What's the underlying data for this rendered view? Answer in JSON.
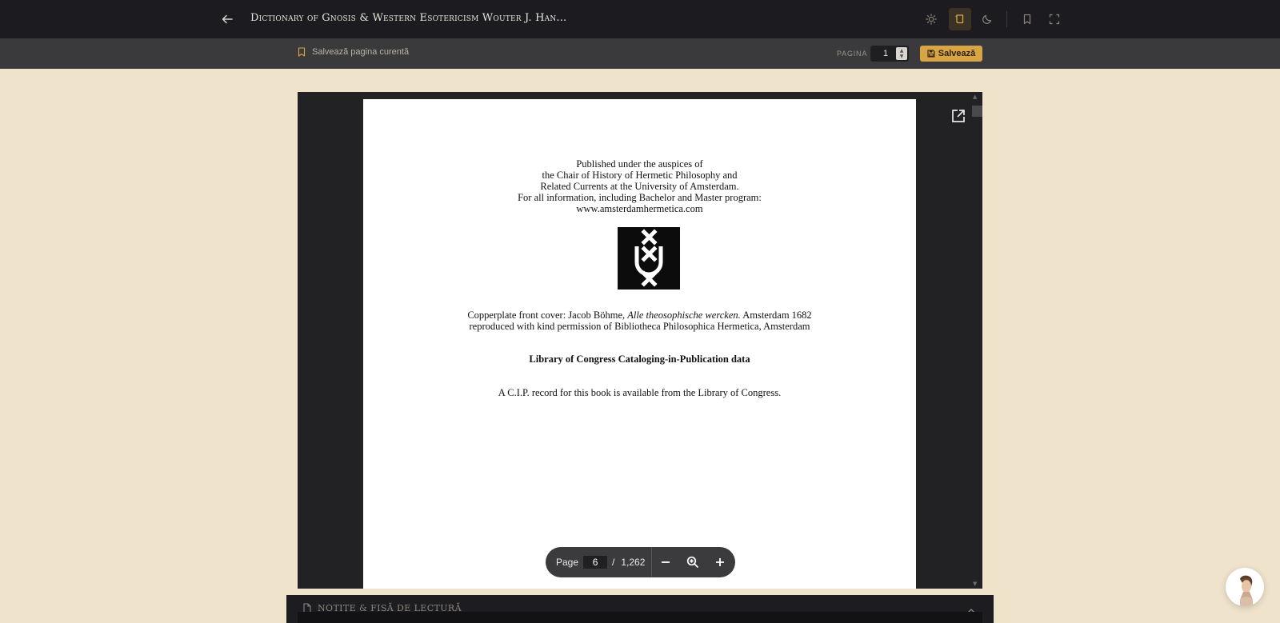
{
  "header": {
    "title": "Dictionary of Gnosis & Western Esotericism Wouter J. Han...",
    "icons": [
      "arrow-left-icon",
      "sun-icon",
      "sepia-book-icon",
      "moon-icon",
      "bookmark-icon",
      "fullscreen-icon"
    ],
    "active_theme": "sepia",
    "accent_color": "#d9a544"
  },
  "subbar": {
    "save_current_label": "Salvează pagina curentă",
    "page_label": "PAGINA",
    "page_value": "1",
    "save_button_label": "Salvează"
  },
  "document": {
    "lines": {
      "l1": "Published under the auspices of",
      "l2": "the Chair of History of Hermetic Philosophy and",
      "l3": "Related Currents at the University of Amsterdam.",
      "l4": "For all information, including Bachelor and Master program:",
      "l5": "www.amsterdamhermetica.com",
      "cover_a": "Copperplate front cover: Jacob Böhme, ",
      "cover_b": "Alle theosophische wercken.",
      "cover_c": " Amsterdam 1682",
      "cover_2": "reproduced with kind permission of Bibliotheca Philosophica Hermetica, Amsterdam",
      "cip_heading": "Library of Congress Cataloging-in-Publication data",
      "cip_text": "A C.I.P. record for this book is available from the Library of Congress."
    },
    "logo_name": "university-of-amsterdam-logo"
  },
  "viewer_nav": {
    "page_label": "Page",
    "current_page": "6",
    "separator": "/",
    "total_pages": "1,262"
  },
  "notes": {
    "label": "NOTIȚE & FIȘĂ DE LECTURĂ"
  }
}
